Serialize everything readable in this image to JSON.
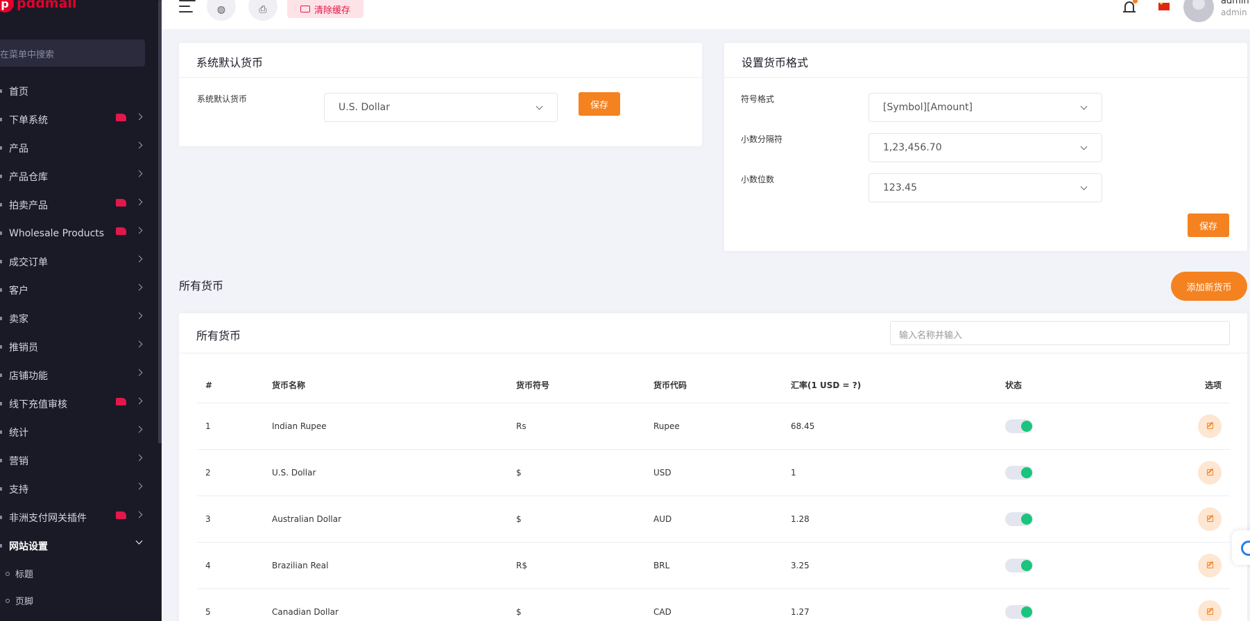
{
  "brand": {
    "logo_letter": "p",
    "name": "pddmall"
  },
  "sidebar": {
    "search_placeholder": "在菜单中搜索",
    "items": [
      {
        "label": "首页",
        "badge": false,
        "chevron": false
      },
      {
        "label": "下单系统",
        "badge": true,
        "chevron": true
      },
      {
        "label": "产品",
        "badge": false,
        "chevron": true
      },
      {
        "label": "产品仓库",
        "badge": false,
        "chevron": true
      },
      {
        "label": "拍卖产品",
        "badge": true,
        "chevron": true
      },
      {
        "label": "Wholesale Products",
        "badge": true,
        "chevron": true
      },
      {
        "label": "成交订单",
        "badge": false,
        "chevron": true
      },
      {
        "label": "客户",
        "badge": false,
        "chevron": true
      },
      {
        "label": "卖家",
        "badge": false,
        "chevron": true
      },
      {
        "label": "推销员",
        "badge": false,
        "chevron": true
      },
      {
        "label": "店铺功能",
        "badge": false,
        "chevron": true
      },
      {
        "label": "线下充值审核",
        "badge": true,
        "chevron": true
      },
      {
        "label": "统计",
        "badge": false,
        "chevron": true
      },
      {
        "label": "营销",
        "badge": false,
        "chevron": true
      },
      {
        "label": "支持",
        "badge": false,
        "chevron": true
      },
      {
        "label": "非洲支付网关插件",
        "badge": true,
        "chevron": true
      },
      {
        "label": "网站设置",
        "badge": false,
        "chevron": true,
        "open": true
      }
    ],
    "sub_items": [
      "标题",
      "页脚"
    ]
  },
  "topbar": {
    "clear_cache_label": "清除缓存",
    "user_name": "admin",
    "user_role": "admin"
  },
  "default_currency": {
    "title": "系统默认货币",
    "label": "系统默认货币",
    "selected": "U.S. Dollar",
    "save_label": "保存"
  },
  "currency_format": {
    "title": "设置货币格式",
    "symbol_label": "符号格式",
    "symbol_value": "[Symbol][Amount]",
    "separator_label": "小数分隔符",
    "separator_value": "1,23,456.70",
    "decimals_label": "小数位数",
    "decimals_value": "123.45",
    "save_label": "保存"
  },
  "all_currencies": {
    "section_title": "所有货币",
    "add_button": "添加新货币",
    "card_title": "所有货币",
    "search_placeholder": "输入名称并输入",
    "columns": [
      "#",
      "货币名称",
      "货币符号",
      "货币代码",
      "汇率(1 USD = ?)",
      "状态",
      "选项"
    ],
    "rows": [
      {
        "no": "1",
        "name": "Indian Rupee",
        "symbol": "Rs",
        "code": "Rupee",
        "rate": "68.45",
        "active": true
      },
      {
        "no": "2",
        "name": "U.S. Dollar",
        "symbol": "$",
        "code": "USD",
        "rate": "1",
        "active": true
      },
      {
        "no": "3",
        "name": "Australian Dollar",
        "symbol": "$",
        "code": "AUD",
        "rate": "1.28",
        "active": true
      },
      {
        "no": "4",
        "name": "Brazilian Real",
        "symbol": "R$",
        "code": "BRL",
        "rate": "3.25",
        "active": true
      },
      {
        "no": "5",
        "name": "Canadian Dollar",
        "symbol": "$",
        "code": "CAD",
        "rate": "1.27",
        "active": true
      }
    ]
  },
  "colors": {
    "accent": "#f58220",
    "sidebar_bg": "#1a1a27",
    "brand": "#e4002b",
    "toggle_on": "#1bc47d"
  }
}
